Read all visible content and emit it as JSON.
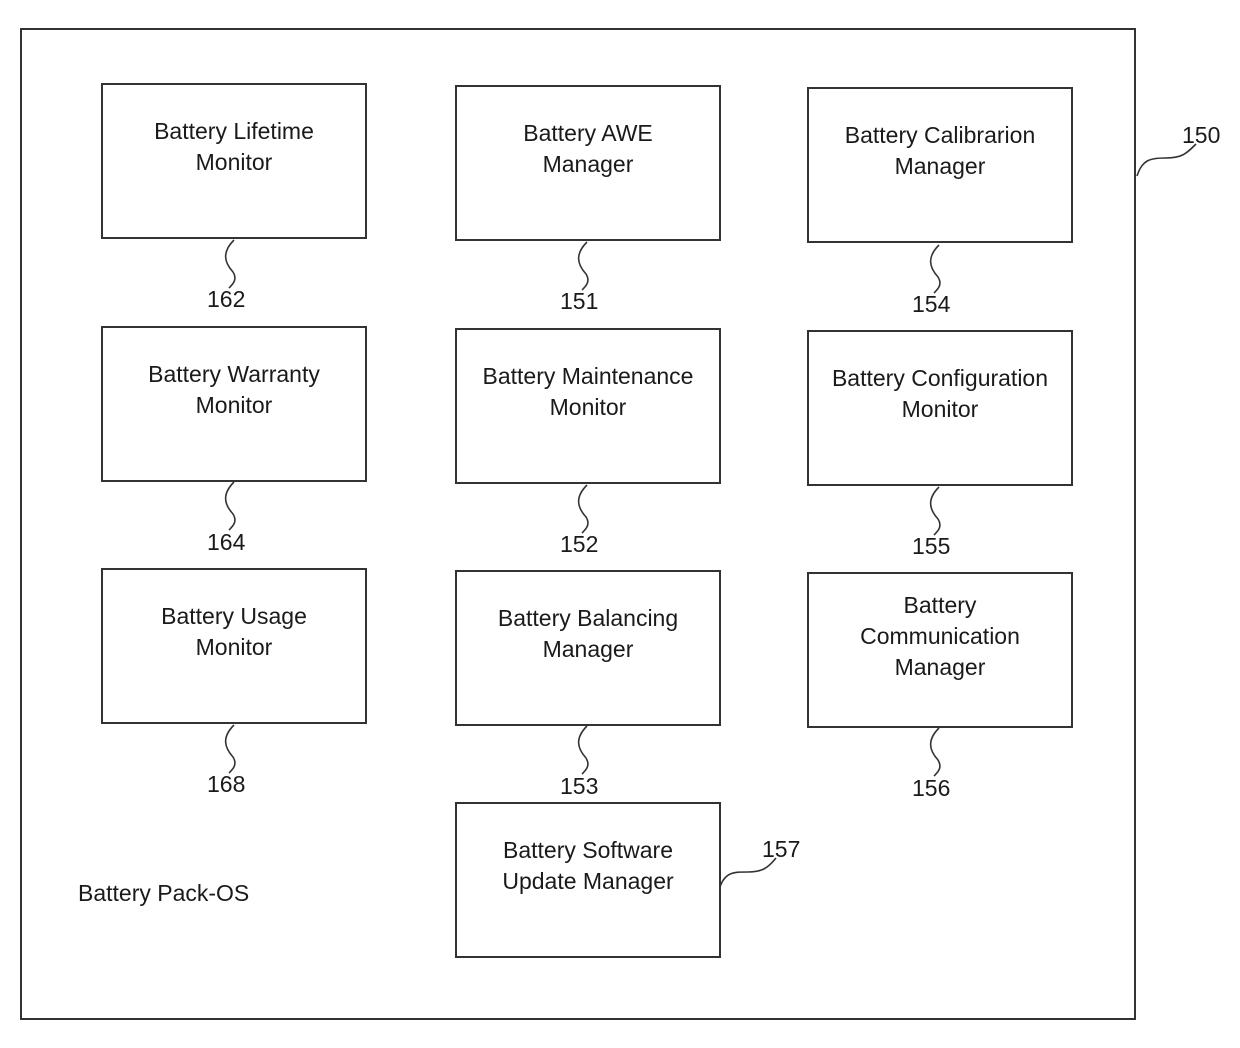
{
  "diagram": {
    "container_label": "Battery Pack-OS",
    "container_ref": "150",
    "modules": [
      {
        "id": "lifetime-monitor",
        "label": "Battery Lifetime\nMonitor",
        "ref": "162"
      },
      {
        "id": "awe-manager",
        "label": "Battery AWE\nManager",
        "ref": "151"
      },
      {
        "id": "calibration-manager",
        "label": "Battery Calibrarion\nManager",
        "ref": "154"
      },
      {
        "id": "warranty-monitor",
        "label": "Battery Warranty\nMonitor",
        "ref": "164"
      },
      {
        "id": "maintenance-monitor",
        "label": "Battery Maintenance\nMonitor",
        "ref": "152"
      },
      {
        "id": "configuration-monitor",
        "label": "Battery Configuration\nMonitor",
        "ref": "155"
      },
      {
        "id": "usage-monitor",
        "label": "Battery Usage\nMonitor",
        "ref": "168"
      },
      {
        "id": "balancing-manager",
        "label": "Battery Balancing\nManager",
        "ref": "153"
      },
      {
        "id": "communication-manager",
        "label": "Battery\nCommunication\nManager",
        "ref": "156"
      },
      {
        "id": "software-update-manager",
        "label": "Battery Software\nUpdate Manager",
        "ref": "157"
      }
    ]
  }
}
